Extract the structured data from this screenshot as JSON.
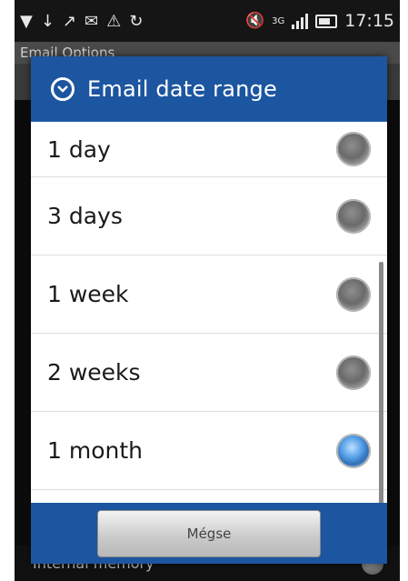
{
  "status_bar": {
    "icons": [
      "usb-debug-icon",
      "download-icon",
      "missed-call-icon",
      "email-icon",
      "warning-icon",
      "sync-icon",
      "mute-icon",
      "3g-icon",
      "signal-icon",
      "battery-icon"
    ],
    "network": "3G",
    "time": "17:15"
  },
  "background": {
    "title": "Email Options",
    "bottom_text": "Internal memory"
  },
  "dialog": {
    "title": "Email date range",
    "options": [
      {
        "label": "1 day",
        "checked": false
      },
      {
        "label": "3 days",
        "checked": false
      },
      {
        "label": "1 week",
        "checked": false
      },
      {
        "label": "2 weeks",
        "checked": false
      },
      {
        "label": "1 month",
        "checked": true
      }
    ],
    "cancel_label": "Mégse"
  },
  "colors": {
    "header_blue": "#1c55a0",
    "radio_checked": "#5aa2ea"
  }
}
